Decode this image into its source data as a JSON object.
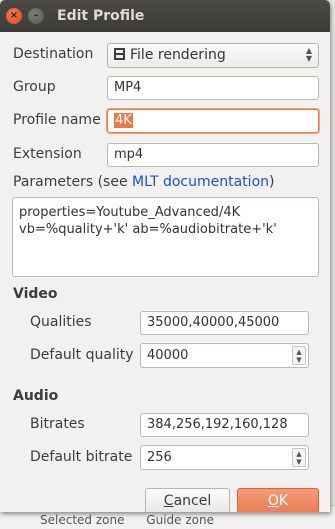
{
  "window": {
    "title": "Edit Profile",
    "close_glyph": "×",
    "minimize_glyph": "–"
  },
  "form": {
    "destination": {
      "label": "Destination",
      "value": "File rendering",
      "icon": "film-icon"
    },
    "group": {
      "label": "Group",
      "value": "MP4"
    },
    "profile_name": {
      "label": "Profile name",
      "value": "4K"
    },
    "extension": {
      "label": "Extension",
      "value": "mp4"
    },
    "parameters": {
      "label_prefix": "Parameters (see ",
      "link_text": "MLT documentation",
      "label_suffix": ")",
      "line1": "properties=Youtube_Advanced/4K",
      "line2": "vb=%quality+'k' ab=%audiobitrate+'k'"
    }
  },
  "video": {
    "section_title": "Video",
    "qualities": {
      "label": "Qualities",
      "value": "35000,40000,45000"
    },
    "default_quality": {
      "label": "Default quality",
      "value": "40000"
    }
  },
  "audio": {
    "section_title": "Audio",
    "bitrates": {
      "label": "Bitrates",
      "value": "384,256,192,160,128"
    },
    "default_bitrate": {
      "label": "Default bitrate",
      "value": "256"
    }
  },
  "buttons": {
    "cancel_mnemonic": "C",
    "cancel_rest": "ancel",
    "ok_mnemonic": "O",
    "ok_rest": "K"
  },
  "background": {
    "item1": "Selected zone",
    "item2": "Guide zone"
  },
  "colors": {
    "accent": "#f07746",
    "titlebar": "#3c3b37",
    "link": "#1c4fd9",
    "dialog_bg": "#f2f1f0"
  }
}
